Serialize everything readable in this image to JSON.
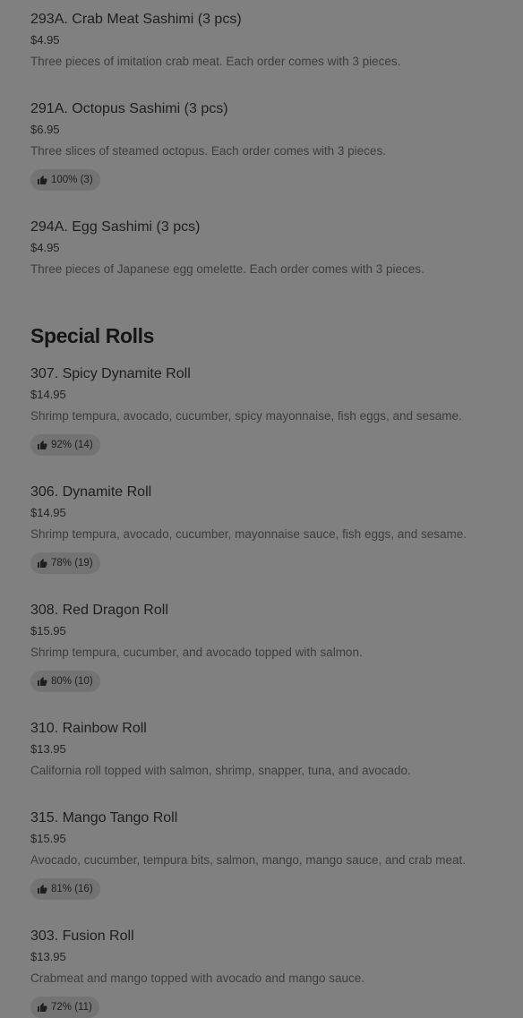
{
  "sections": [
    {
      "title": "",
      "items": [
        {
          "name": "293A. Crab Meat Sashimi (3 pcs)",
          "price": "$4.95",
          "description": "Three pieces of imitation crab meat. Each order comes with 3 pieces.",
          "rating": ""
        },
        {
          "name": "291A. Octopus Sashimi (3 pcs)",
          "price": "$6.95",
          "description": "Three slices of steamed octopus. Each order comes with 3 pieces.",
          "rating": "100% (3)"
        },
        {
          "name": "294A. Egg Sashimi (3 pcs)",
          "price": "$4.95",
          "description": "Three pieces of Japanese egg omelette. Each order comes with 3 pieces.",
          "rating": ""
        }
      ]
    },
    {
      "title": "Special Rolls",
      "items": [
        {
          "name": "307. Spicy Dynamite Roll",
          "price": "$14.95",
          "description": "Shrimp tempura, avocado, cucumber, spicy mayonnaise, fish eggs, and sesame.",
          "rating": "92% (14)"
        },
        {
          "name": "306. Dynamite Roll",
          "price": "$14.95",
          "description": "Shrimp tempura, avocado, cucumber, mayonnaise sauce, fish eggs, and sesame.",
          "rating": "78% (19)"
        },
        {
          "name": "308. Red Dragon Roll",
          "price": "$15.95",
          "description": "Shrimp tempura, cucumber, and avocado topped with salmon.",
          "rating": "80% (10)"
        },
        {
          "name": "310. Rainbow Roll",
          "price": "$13.95",
          "description": "California roll topped with salmon, shrimp, snapper, tuna, and avocado.",
          "rating": ""
        },
        {
          "name": "315. Mango Tango Roll",
          "price": "$15.95",
          "description": "Avocado, cucumber, tempura bits, salmon, mango, mango sauce, and crab meat.",
          "rating": "81% (16)"
        },
        {
          "name": "303. Fusion Roll",
          "price": "$13.95",
          "description": "Crabmeat and mango topped with avocado and mango sauce.",
          "rating": "72% (11)"
        }
      ]
    }
  ],
  "icons": {
    "rating": "thumbs-up-icon"
  }
}
